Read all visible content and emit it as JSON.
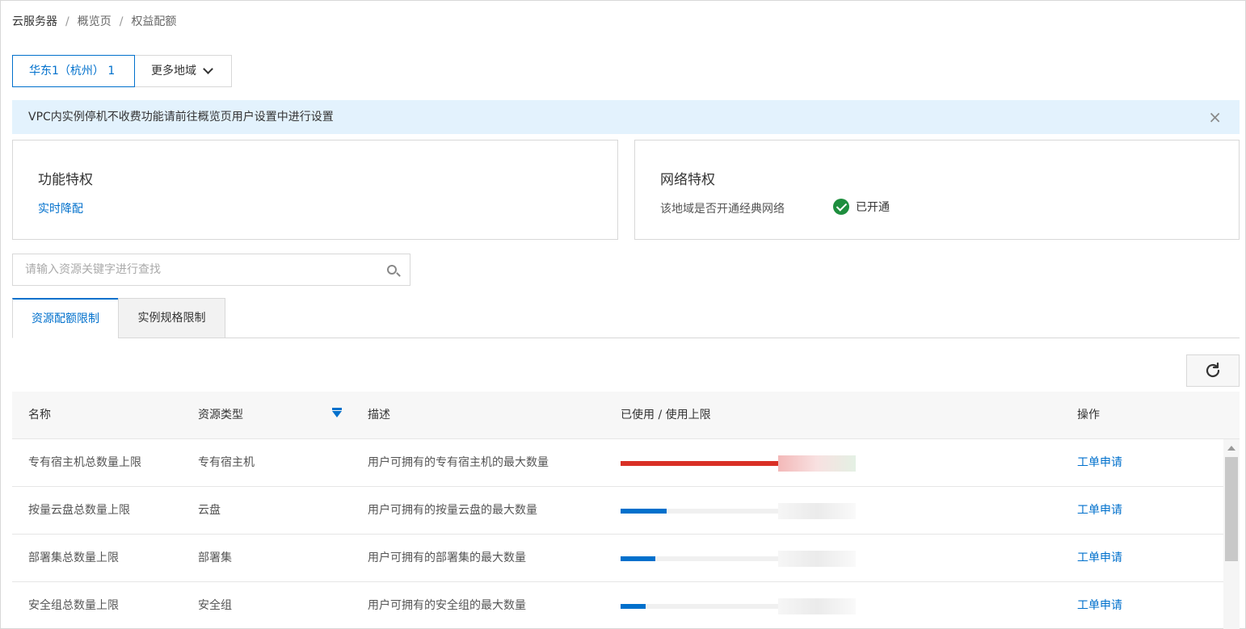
{
  "breadcrumb": [
    "云服务器",
    "概览页",
    "权益配额"
  ],
  "breadcrumb_separator": "/",
  "region": {
    "active_label": "华东1（杭州） 1",
    "more_label": "更多地域"
  },
  "notice": {
    "text": "VPC内实例停机不收费功能请前往概览页用户设置中进行设置",
    "close": "×"
  },
  "feature_card": {
    "title": "功能特权",
    "link": "实时降配"
  },
  "network_card": {
    "title": "网络特权",
    "question": "该地域是否开通经典网络",
    "status": "已开通",
    "status_color": "#1e8e3e"
  },
  "search": {
    "placeholder": "请输入资源关键字进行查找",
    "icon": "search-icon"
  },
  "tabs": [
    "资源配额限制",
    "实例规格限制"
  ],
  "refresh_icon": "refresh-icon",
  "table": {
    "headers": [
      "名称",
      "资源类型",
      "描述",
      "已使用 / 使用上限",
      "操作"
    ],
    "rows": [
      {
        "name": "专有宿主机总数量上限",
        "type": "专有宿主机",
        "desc": "用户可拥有的专有宿主机的最大数量",
        "usage": 1.0,
        "action": "工单申请"
      },
      {
        "name": "按量云盘总数量上限",
        "type": "云盘",
        "desc": "用户可拥有的按量云盘的最大数量",
        "usage": 0.29,
        "action": "工单申请"
      },
      {
        "name": "部署集总数量上限",
        "type": "部署集",
        "desc": "用户可拥有的部署集的最大数量",
        "usage": 0.22,
        "action": "工单申请"
      },
      {
        "name": "安全组总数量上限",
        "type": "安全组",
        "desc": "用户可拥有的安全组的最大数量",
        "usage": 0.16,
        "action": "工单申请"
      }
    ]
  },
  "colors": {
    "accent": "#0070cc",
    "danger": "#d93026",
    "notice_bg": "#e3f2fd"
  }
}
